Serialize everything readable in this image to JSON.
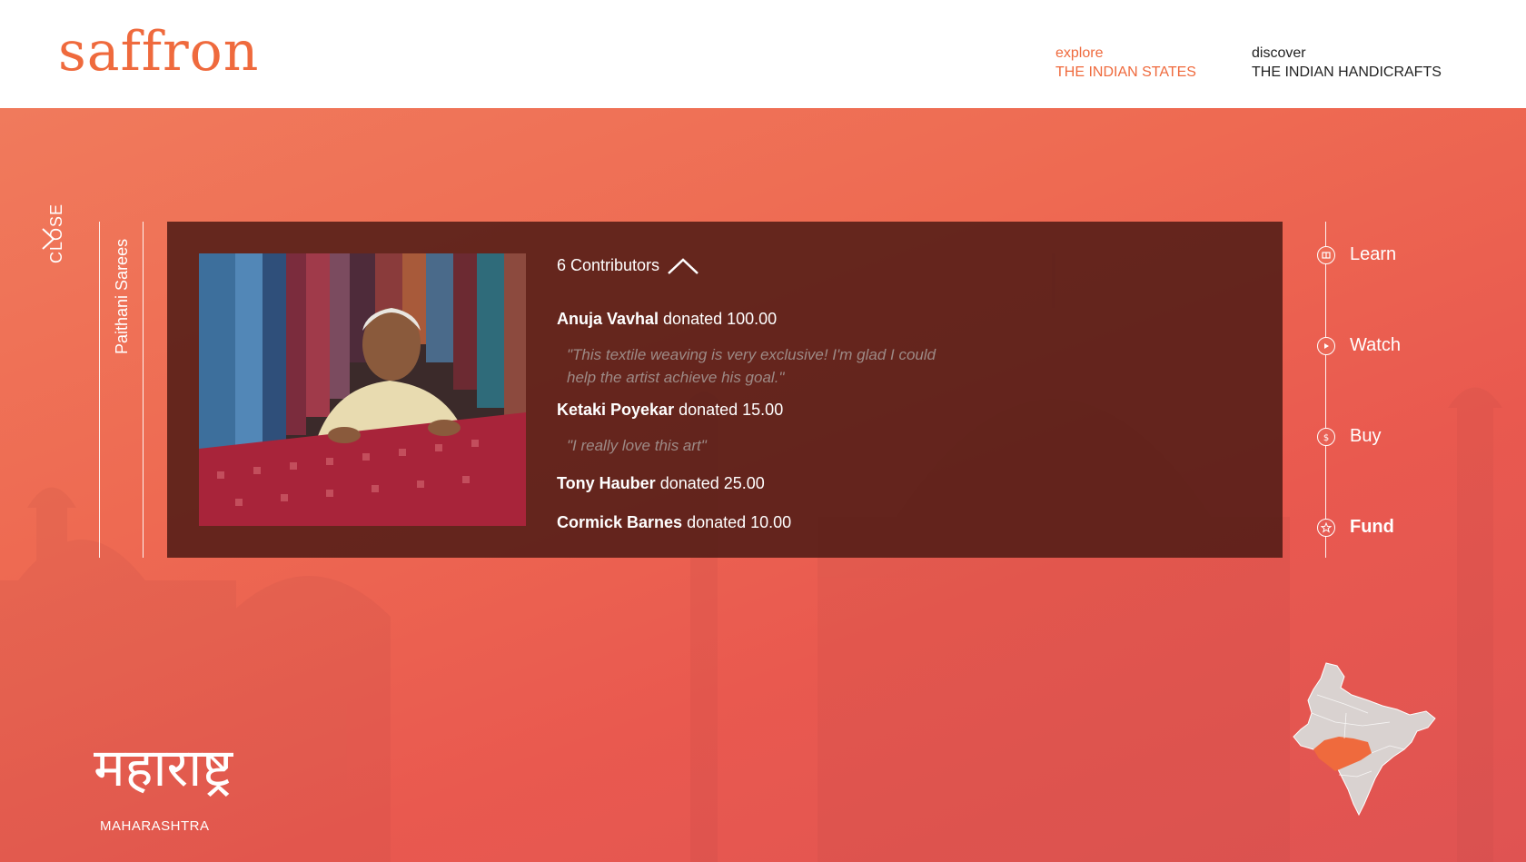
{
  "brand": {
    "logo_text": "saffron"
  },
  "nav": {
    "explore": {
      "small": "explore",
      "big": "THE INDIAN STATES"
    },
    "discover": {
      "small": "discover",
      "big": "THE INDIAN HANDICRAFTS"
    }
  },
  "close": {
    "label": "CLOSE"
  },
  "category": {
    "label": "Paithani Sarees"
  },
  "contributors": {
    "header": "6 Contributors",
    "items": [
      {
        "name": "Anuja Vavhal",
        "action": " donated ",
        "amount": "100.00",
        "quote": "\"This textile weaving is very exclusive! I'm glad I could help the artist achieve his goal.\""
      },
      {
        "name": "Ketaki Poyekar",
        "action": " donated ",
        "amount": "15.00",
        "quote": "\"I really love this art\""
      },
      {
        "name": "Tony Hauber",
        "action": " donated ",
        "amount": "25.00",
        "quote": ""
      },
      {
        "name": "Cormick Barnes",
        "action": " donated ",
        "amount": "10.00",
        "quote": ""
      }
    ]
  },
  "side_menu": {
    "learn": "Learn",
    "watch": "Watch",
    "buy": "Buy",
    "fund": "Fund",
    "active": "Fund"
  },
  "state": {
    "devanagari": "महाराष्ट्र",
    "name": "MAHARASHTRA"
  },
  "colors": {
    "accent": "#ef6a3d",
    "hero_top": "#f07a5c",
    "hero_bottom": "#df5352",
    "card_bg": "#4c1a14",
    "highlight_state": "#ef6a3d",
    "map_gray": "#d9d2d0"
  },
  "icons": {
    "close": "chevron-right-icon",
    "collapse": "chevron-up-icon",
    "learn": "book-icon",
    "watch": "play-icon",
    "buy": "dollar-icon",
    "fund": "star-icon"
  }
}
